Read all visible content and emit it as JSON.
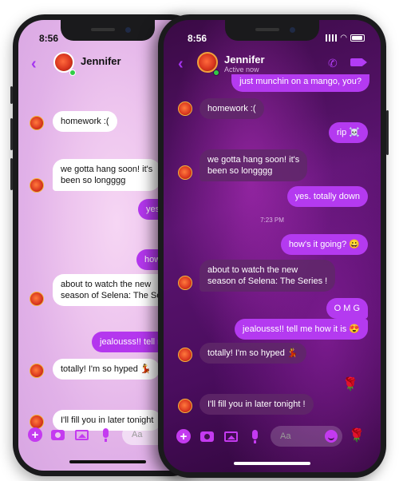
{
  "light_phone": {
    "status_time": "8:56",
    "contact_name": "Jennifer",
    "messages": [
      {
        "from": "them",
        "text": "homework :("
      },
      {
        "from": "them",
        "text": "we gotta hang soon! it's"
      },
      {
        "from": "them",
        "text": "been so longggg"
      },
      {
        "from": "me",
        "text": "yes"
      },
      {
        "from": "me",
        "text": "how'"
      },
      {
        "from": "them",
        "text": "about to watch the new"
      },
      {
        "from": "them",
        "text": "season of Selena: The Se"
      },
      {
        "from": "me",
        "text": "jealousss!! tell m"
      },
      {
        "from": "them",
        "text": "totally! I'm so hyped 💃"
      },
      {
        "from": "them",
        "text": "I'll fill you in later tonight"
      }
    ],
    "composer_placeholder": "Aa"
  },
  "dark_phone": {
    "status_time": "8:56",
    "contact_name": "Jennifer",
    "contact_status": "Active now",
    "top_partial": "just munchin on a mango, you?",
    "messages": [
      {
        "from": "them",
        "text": "homework :("
      },
      {
        "from": "me",
        "text": "rip ☠️"
      },
      {
        "from": "them",
        "text": "we gotta hang soon! it's"
      },
      {
        "from": "them",
        "text": "been so longggg"
      },
      {
        "from": "me",
        "text": "yes. totally down"
      },
      {
        "from": "me",
        "text": "how's it going? 😀"
      },
      {
        "from": "them",
        "text": "about to watch the new"
      },
      {
        "from": "them",
        "text": "season of Selena: The Series !"
      },
      {
        "from": "me",
        "text": "O M G"
      },
      {
        "from": "me",
        "text": "jealousss!! tell me how it is 😍"
      },
      {
        "from": "them",
        "text": "totally! I'm so hyped 💃"
      },
      {
        "from": "them",
        "text": "I'll fill you in later tonight !"
      }
    ],
    "timestamp": "7:23 PM",
    "rose": "🌹",
    "composer_placeholder": "Aa"
  },
  "colors": {
    "accent": "#b43af0",
    "online": "#31cc46"
  },
  "icons": [
    "back-chevron-icon",
    "phone-icon",
    "video-icon",
    "plus-icon",
    "camera-icon",
    "image-icon",
    "mic-icon",
    "emoji-icon",
    "rose-icon"
  ]
}
